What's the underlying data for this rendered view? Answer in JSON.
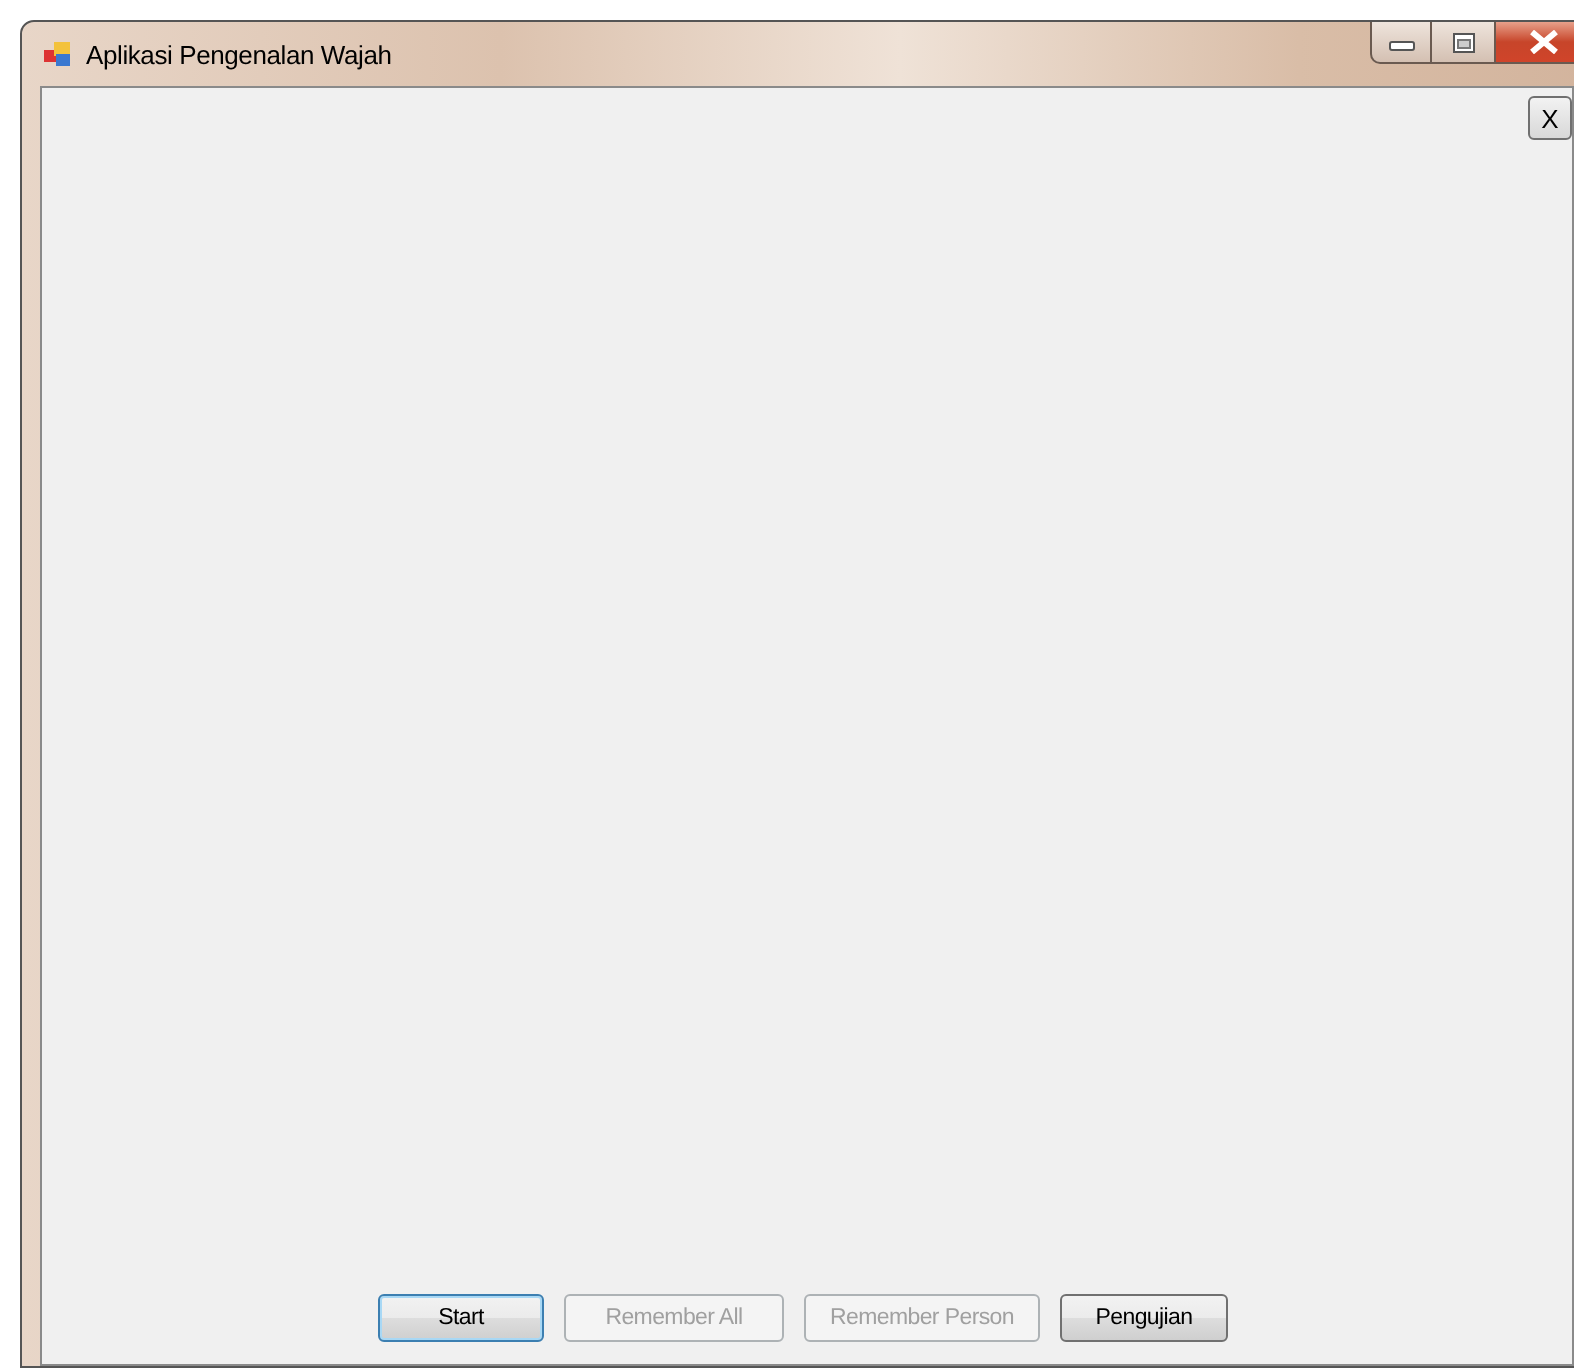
{
  "window": {
    "title": "Aplikasi Pengenalan Wajah",
    "caption_buttons": [
      {
        "kind": "minimize"
      },
      {
        "kind": "maximize"
      },
      {
        "kind": "close"
      }
    ]
  },
  "close_panel_button": {
    "label": "X"
  },
  "buttons": [
    {
      "label": "Start",
      "disabled": false,
      "default": true
    },
    {
      "label": "Remember All",
      "disabled": true,
      "default": false
    },
    {
      "label": "Remember Person",
      "disabled": true,
      "default": false
    },
    {
      "label": "Pengujian",
      "disabled": false,
      "default": false
    }
  ]
}
